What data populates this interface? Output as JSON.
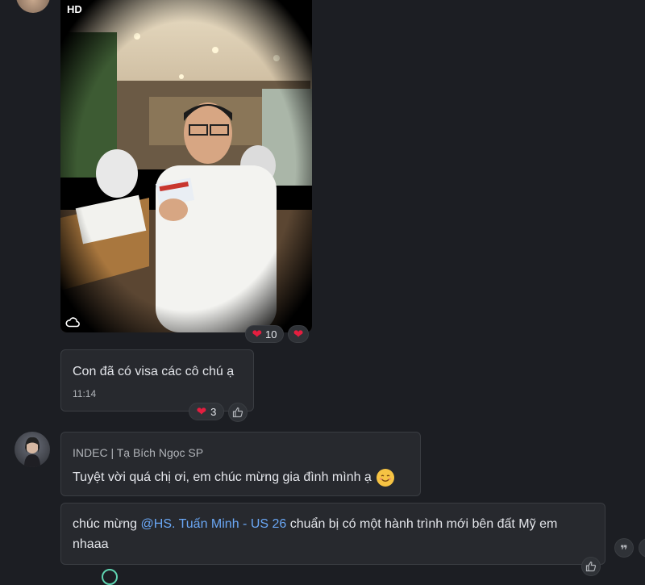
{
  "photo_message": {
    "hd_badge": "HD",
    "reaction_count": "10"
  },
  "visa_message": {
    "text": "Con đã có visa các cô chú ạ",
    "time": "11:14",
    "reaction_count": "3"
  },
  "reply_message": {
    "sender": "INDEC | Tạ Bích Ngọc SP",
    "text": "Tuyệt vời quá chị ơi, em chúc mừng gia đình mình ạ",
    "emoji": "😊"
  },
  "congrats_message": {
    "prefix": "chúc mừng ",
    "mention": "@HS. Tuấn Minh - US 26",
    "suffix": " chuẩn bị có một hành trình mới bên đất Mỹ em",
    "line2": "nhaaa"
  },
  "colors": {
    "background": "#1c1e23",
    "bubble": "#27292e",
    "heart": "#e41e3f",
    "mention": "#6aa7f5"
  }
}
